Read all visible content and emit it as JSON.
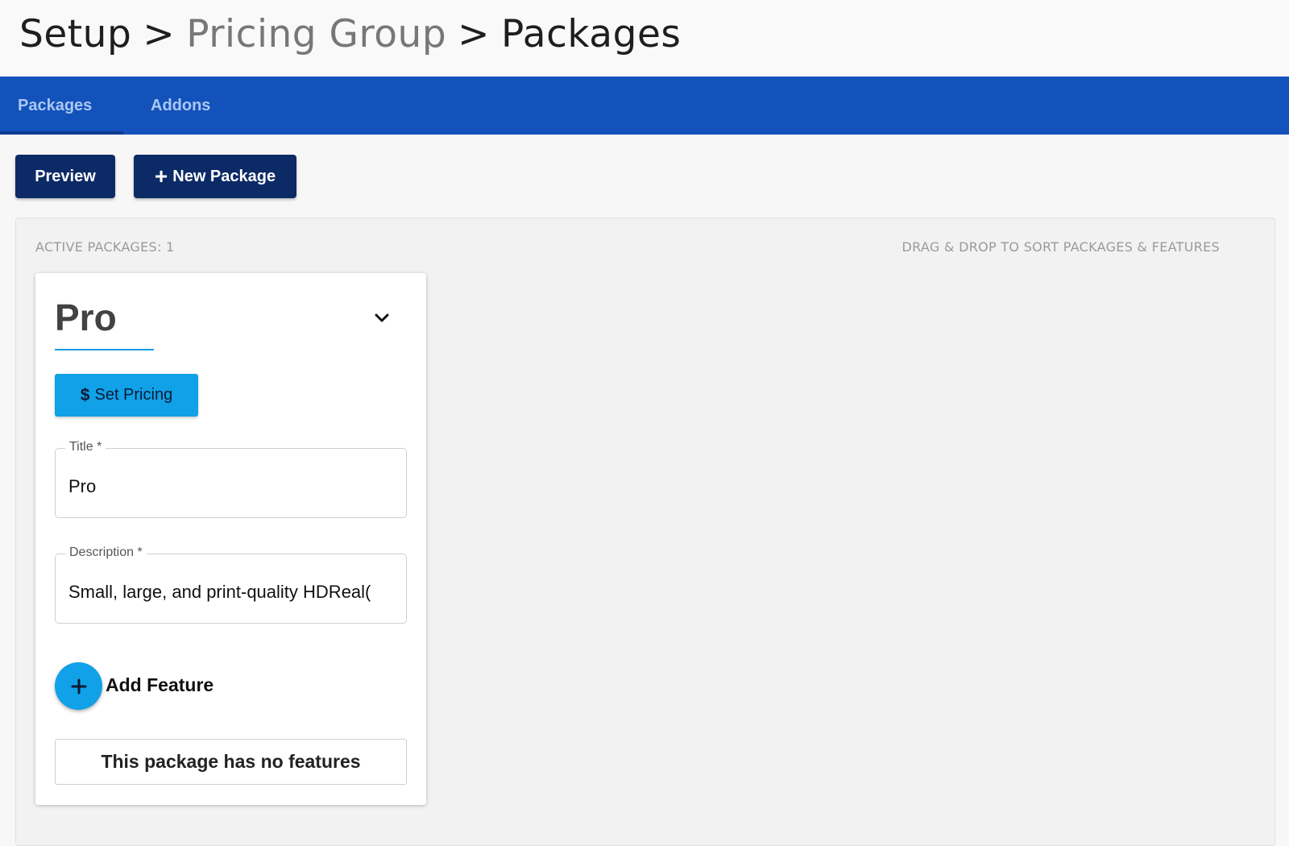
{
  "breadcrumb": {
    "root": "Setup",
    "separator": ">",
    "middle": "Pricing Group",
    "current": "Packages"
  },
  "tabs": [
    {
      "label": "Packages",
      "active": true
    },
    {
      "label": "Addons",
      "active": false
    }
  ],
  "toolbar": {
    "preview_label": "Preview",
    "new_package_label": "New Package"
  },
  "panel": {
    "active_packages": "ACTIVE PACKAGES: 1",
    "hint": "DRAG & DROP TO SORT PACKAGES & FEATURES"
  },
  "package": {
    "name": "Pro",
    "set_pricing_label": "Set Pricing",
    "title_label": "Title *",
    "title_value": "Pro",
    "description_label": "Description *",
    "description_value": "Small, large, and print-quality HDReal(",
    "add_feature_label": "Add Feature",
    "no_features_text": "This package has no features"
  },
  "colors": {
    "tabbar": "#1351bb",
    "primary_dark": "#0c2a66",
    "accent": "#10a1e8"
  },
  "icons": [
    "plus-icon",
    "chevron-down-icon",
    "dollar-icon"
  ]
}
